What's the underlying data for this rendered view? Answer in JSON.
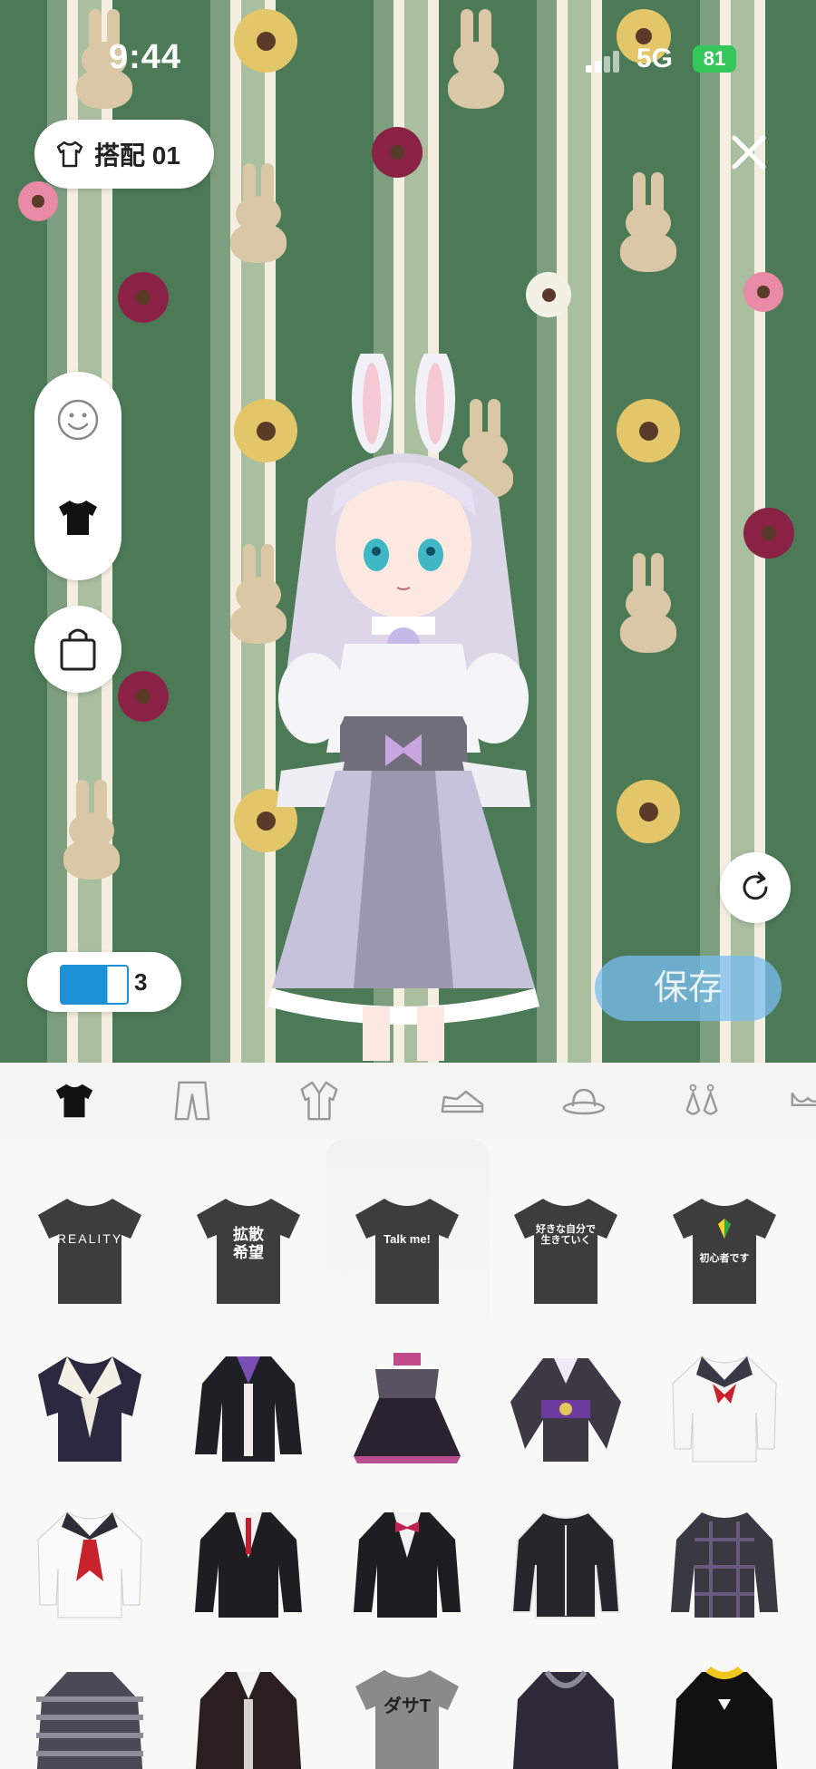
{
  "status_bar": {
    "time": "9:44",
    "network": "5G",
    "battery": "81"
  },
  "header": {
    "outfit_label": "搭配 01",
    "outfit_icon": "tshirt-icon",
    "close_icon": "close-icon"
  },
  "side_tools": {
    "face_icon": "smiley-face-icon",
    "clothes_icon": "tshirt-icon",
    "shop_icon": "shopping-bag-icon"
  },
  "rotate_icon": "rotate-icon",
  "ticket": {
    "icon": "ticket-icon",
    "count": "3"
  },
  "save_button": {
    "label": "保存"
  },
  "categories": [
    {
      "name": "tops",
      "icon": "tshirt-icon",
      "active": true
    },
    {
      "name": "bottoms",
      "icon": "pants-icon",
      "active": false
    },
    {
      "name": "outerwear",
      "icon": "coat-icon",
      "active": false
    },
    {
      "name": "shoes",
      "icon": "shoe-icon",
      "active": false
    },
    {
      "name": "hats",
      "icon": "hat-icon",
      "active": false
    },
    {
      "name": "earrings",
      "icon": "earrings-icon",
      "active": false
    },
    {
      "name": "underwear",
      "icon": "bra-icon",
      "active": false
    }
  ],
  "items": {
    "row1": [
      {
        "type": "tshirt",
        "print": "REALITY"
      },
      {
        "type": "tshirt",
        "print": "拡散\n希望"
      },
      {
        "type": "tshirt",
        "print": "Talk me!"
      },
      {
        "type": "tshirt",
        "print": "好きな自分で\n生きていく"
      },
      {
        "type": "tshirt",
        "print": "初心者です"
      }
    ],
    "row3_print": "ダサT"
  },
  "colors": {
    "accent": "#1e90d6",
    "save_button": "#78bef0",
    "battery": "#34c759",
    "tab_background": "#f4f4f4",
    "shirt": "#3d3d3d"
  }
}
